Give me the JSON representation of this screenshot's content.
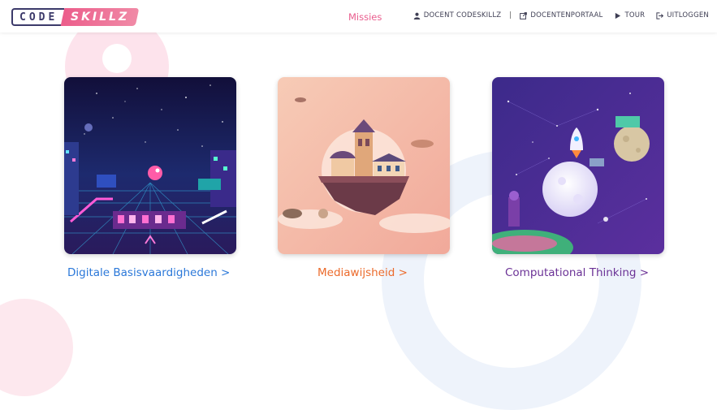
{
  "header": {
    "logo": {
      "code": "CODE",
      "skillz": "SKILLZ"
    },
    "nav_missies": "Missies",
    "user_label": "DOCENT CODESKILLZ",
    "separator": "|",
    "portal_label": "DOCENTENPORTAAL",
    "tour_label": "TOUR",
    "logout_label": "UITLOGGEN"
  },
  "missions": [
    {
      "title": "Digitale Basisvaardigheden >",
      "color": "#2b78d9"
    },
    {
      "title": "Mediawijsheid >",
      "color": "#ec6b2c"
    },
    {
      "title": "Computational Thinking >",
      "color": "#6b3296"
    }
  ],
  "colors": {
    "brand_pink": "#e95d8e",
    "nav_text": "#3f3f54"
  },
  "icons": {
    "user": "user-icon",
    "portal": "external-link-icon",
    "tour": "play-icon",
    "logout": "logout-icon"
  }
}
